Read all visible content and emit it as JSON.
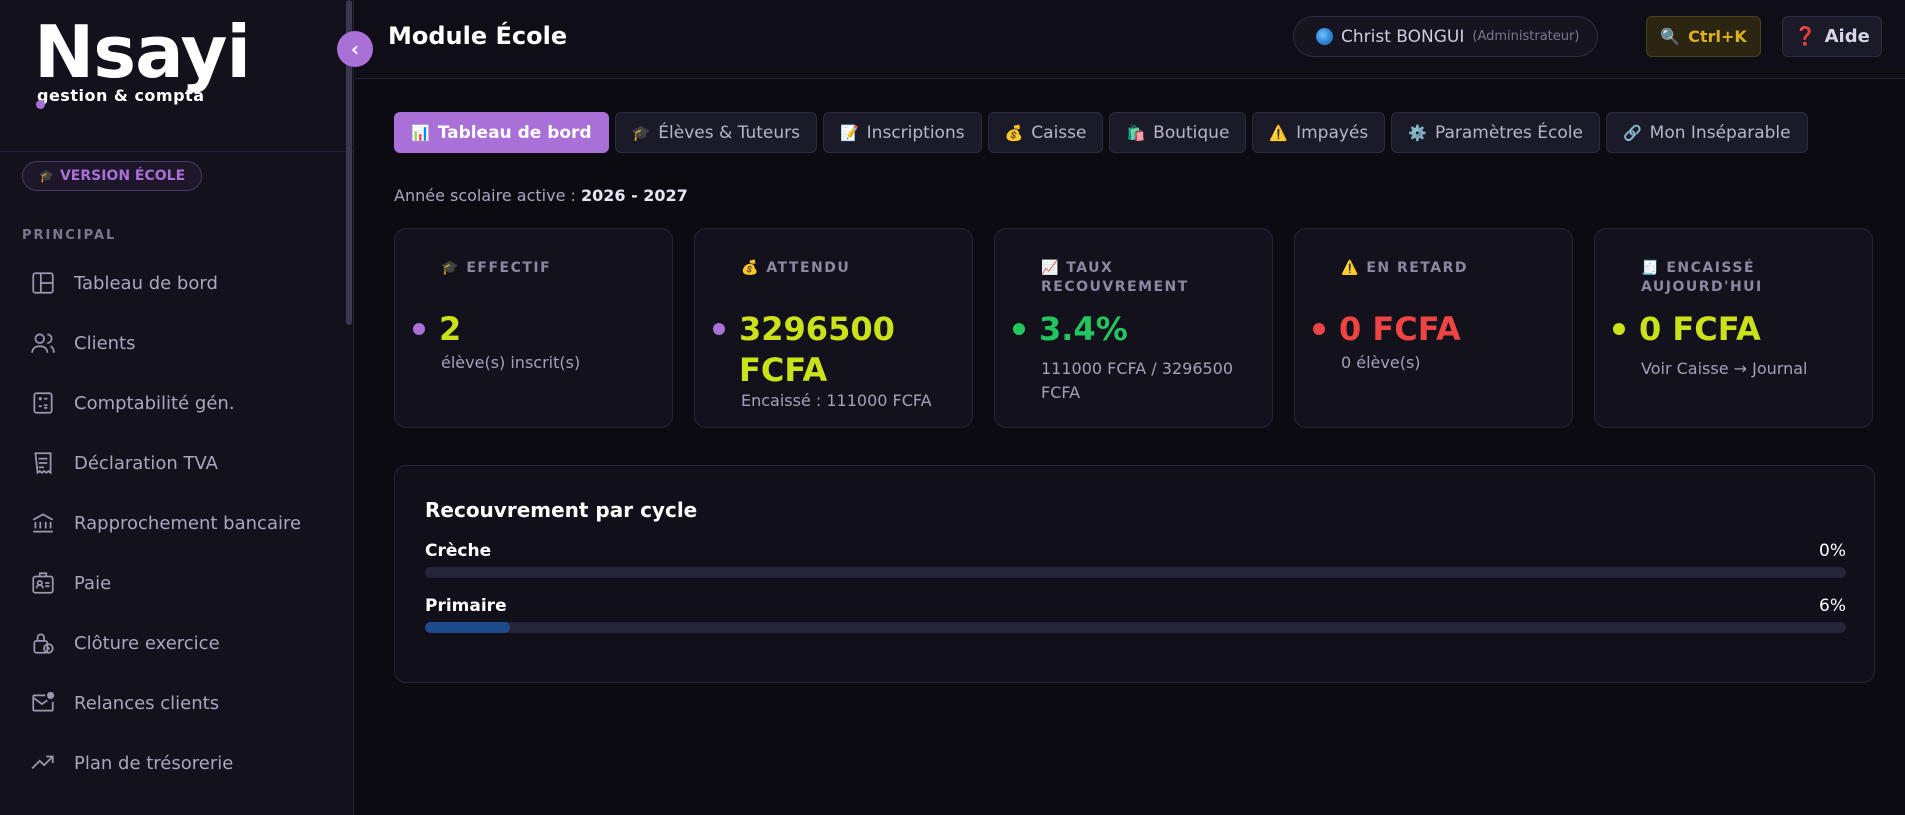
{
  "sidebar": {
    "logo_main": "Nsayi",
    "logo_sub": "gestion & compta",
    "version_badge": "VERSION ÉCOLE",
    "section_label": "PRINCIPAL",
    "items": [
      {
        "label": "Tableau de bord",
        "icon": "dashboard-icon"
      },
      {
        "label": "Clients",
        "icon": "users-icon"
      },
      {
        "label": "Comptabilité gén.",
        "icon": "calculator-icon"
      },
      {
        "label": "Déclaration TVA",
        "icon": "receipt-icon"
      },
      {
        "label": "Rapprochement bancaire",
        "icon": "bank-icon"
      },
      {
        "label": "Paie",
        "icon": "id-card-icon"
      },
      {
        "label": "Clôture exercice",
        "icon": "lock-clock-icon"
      },
      {
        "label": "Relances clients",
        "icon": "mail-notification-icon"
      },
      {
        "label": "Plan de trésorerie",
        "icon": "trending-up-icon"
      }
    ]
  },
  "header": {
    "title": "Module École",
    "user_name": "Christ BONGUI",
    "user_role": "(Administrateur)",
    "search_label": "Ctrl+K",
    "help_label": "Aide"
  },
  "tabs": [
    {
      "icon": "📊",
      "label": "Tableau de bord",
      "active": true
    },
    {
      "icon": "🎓",
      "label": "Élèves & Tuteurs"
    },
    {
      "icon": "📝",
      "label": "Inscriptions"
    },
    {
      "icon": "💰",
      "label": "Caisse"
    },
    {
      "icon": "🛍️",
      "label": "Boutique"
    },
    {
      "icon": "⚠️",
      "label": "Impayés"
    },
    {
      "icon": "⚙️",
      "label": "Paramètres École"
    },
    {
      "icon": "🔗",
      "label": "Mon Inséparable"
    }
  ],
  "school_year": {
    "prefix": "Année scolaire active : ",
    "value": "2026 - 2027"
  },
  "cards": [
    {
      "icon": "🎓",
      "label": "EFFECTIF",
      "value": "2",
      "sub": "élève(s) inscrit(s)",
      "color": "#c9e21a",
      "dot": "#a970d8"
    },
    {
      "icon": "💰",
      "label": "ATTENDU",
      "value": "3296500 FCFA",
      "sub": "Encaissé : 111000 FCFA",
      "color": "#c9e21a",
      "dot": "#a970d8"
    },
    {
      "icon": "📈",
      "label": "TAUX RECOUVREMENT",
      "value": "3.4%",
      "sub": "111000 FCFA / 3296500 FCFA",
      "color": "#22c55e",
      "dot": "#22c55e"
    },
    {
      "icon": "⚠️",
      "label": "EN RETARD",
      "value": "0 FCFA",
      "sub": "0 élève(s)",
      "color": "#ef4444",
      "dot": "#ef4444"
    },
    {
      "icon": "🧾",
      "label": "ENCAISSÉ AUJOURD'HUI",
      "value": "0 FCFA",
      "sub": "Voir Caisse → Journal",
      "color": "#c9e21a",
      "dot": "#c9e21a"
    }
  ],
  "recovery": {
    "title": "Recouvrement par cycle",
    "cycles": [
      {
        "name": "Crèche",
        "percent_label": "0%",
        "fraction": 0
      },
      {
        "name": "Primaire",
        "percent_label": "6%",
        "fraction": 0.06
      }
    ]
  },
  "colors": {
    "accent": "#a970d8",
    "lime": "#c9e21a",
    "green": "#22c55e",
    "red": "#ef4444",
    "progress": "#1d4a8a"
  }
}
